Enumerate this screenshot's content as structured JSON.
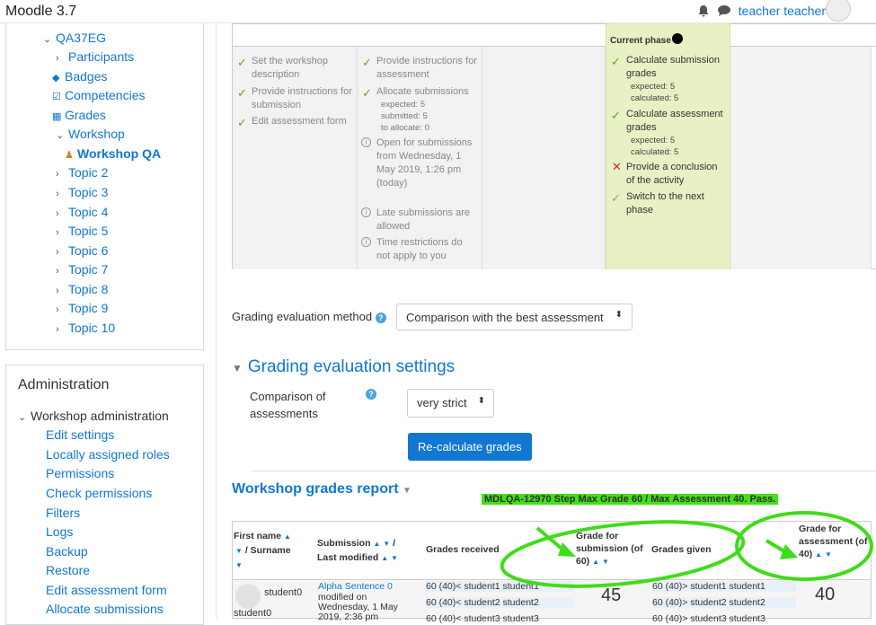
{
  "header": {
    "brand": "Moodle 3.7",
    "user": "teacher teacher"
  },
  "nav": {
    "course": "QA37EG",
    "items": [
      "Participants",
      "Badges",
      "Competencies",
      "Grades",
      "Workshop",
      "Workshop QA",
      "Topic 2",
      "Topic 3",
      "Topic 4",
      "Topic 5",
      "Topic 6",
      "Topic 7",
      "Topic 8",
      "Topic 9",
      "Topic 10"
    ]
  },
  "admin": {
    "title": "Administration",
    "section": "Workshop administration",
    "links": [
      "Edit settings",
      "Locally assigned roles",
      "Permissions",
      "Check permissions",
      "Filters",
      "Logs",
      "Backup",
      "Restore",
      "Edit assessment form",
      "Allocate submissions"
    ]
  },
  "phases": {
    "col1": [
      "Set the workshop description",
      "Provide instructions for submission",
      "Edit assessment form"
    ],
    "col2": [
      "Provide instructions for assessment",
      "Allocate submissions",
      "expected: 5",
      "submitted: 5",
      "to allocate: 0",
      "Open for submissions from Wednesday, 1 May 2019, 1:26 pm (today)",
      "Late submissions are allowed",
      "Time restrictions do not apply to you"
    ],
    "current_label": "Current phase",
    "col4": [
      "Calculate submission grades",
      "expected: 5",
      "calculated: 5",
      "Calculate assessment grades",
      "expected: 5",
      "calculated: 5",
      "Provide a conclusion of the activity",
      "Switch to the next phase"
    ]
  },
  "grading": {
    "method_label": "Grading evaluation method",
    "method_value": "Comparison with the best assessment",
    "settings_title": "Grading evaluation settings",
    "comparison_label": "Comparison of assessments",
    "comparison_value": "very strict",
    "recalc_button": "Re-calculate grades"
  },
  "report": {
    "title": "Workshop grades report",
    "annotation": "MDLQA-12970 Step Max Grade 60 / Max Assessment 40.  Pass.",
    "headers": {
      "first_name": "First name",
      "surname": "/ Surname",
      "submission": "Submission",
      "last_modified": "Last modified",
      "received": "Grades received",
      "grade_sub": "Grade for submission (of 60)",
      "given": "Grades given",
      "grade_assess": "Grade for assessment (of 40)"
    },
    "row": {
      "student": "student0",
      "student2": "student0",
      "submission": "Alpha Sentence 0",
      "modified": "modified on Wednesday, 1 May 2019, 2:36 pm",
      "received": [
        "60 (40)< student1 student1",
        "60 (40)< student2 student2",
        "60 (40)< student3 student3"
      ],
      "grade_sub": "45",
      "given": [
        "60 (40)> student1 student1",
        "60 (40)> student2 student2",
        "60 (40)> student3 student3"
      ],
      "grade_assess": "40"
    }
  }
}
